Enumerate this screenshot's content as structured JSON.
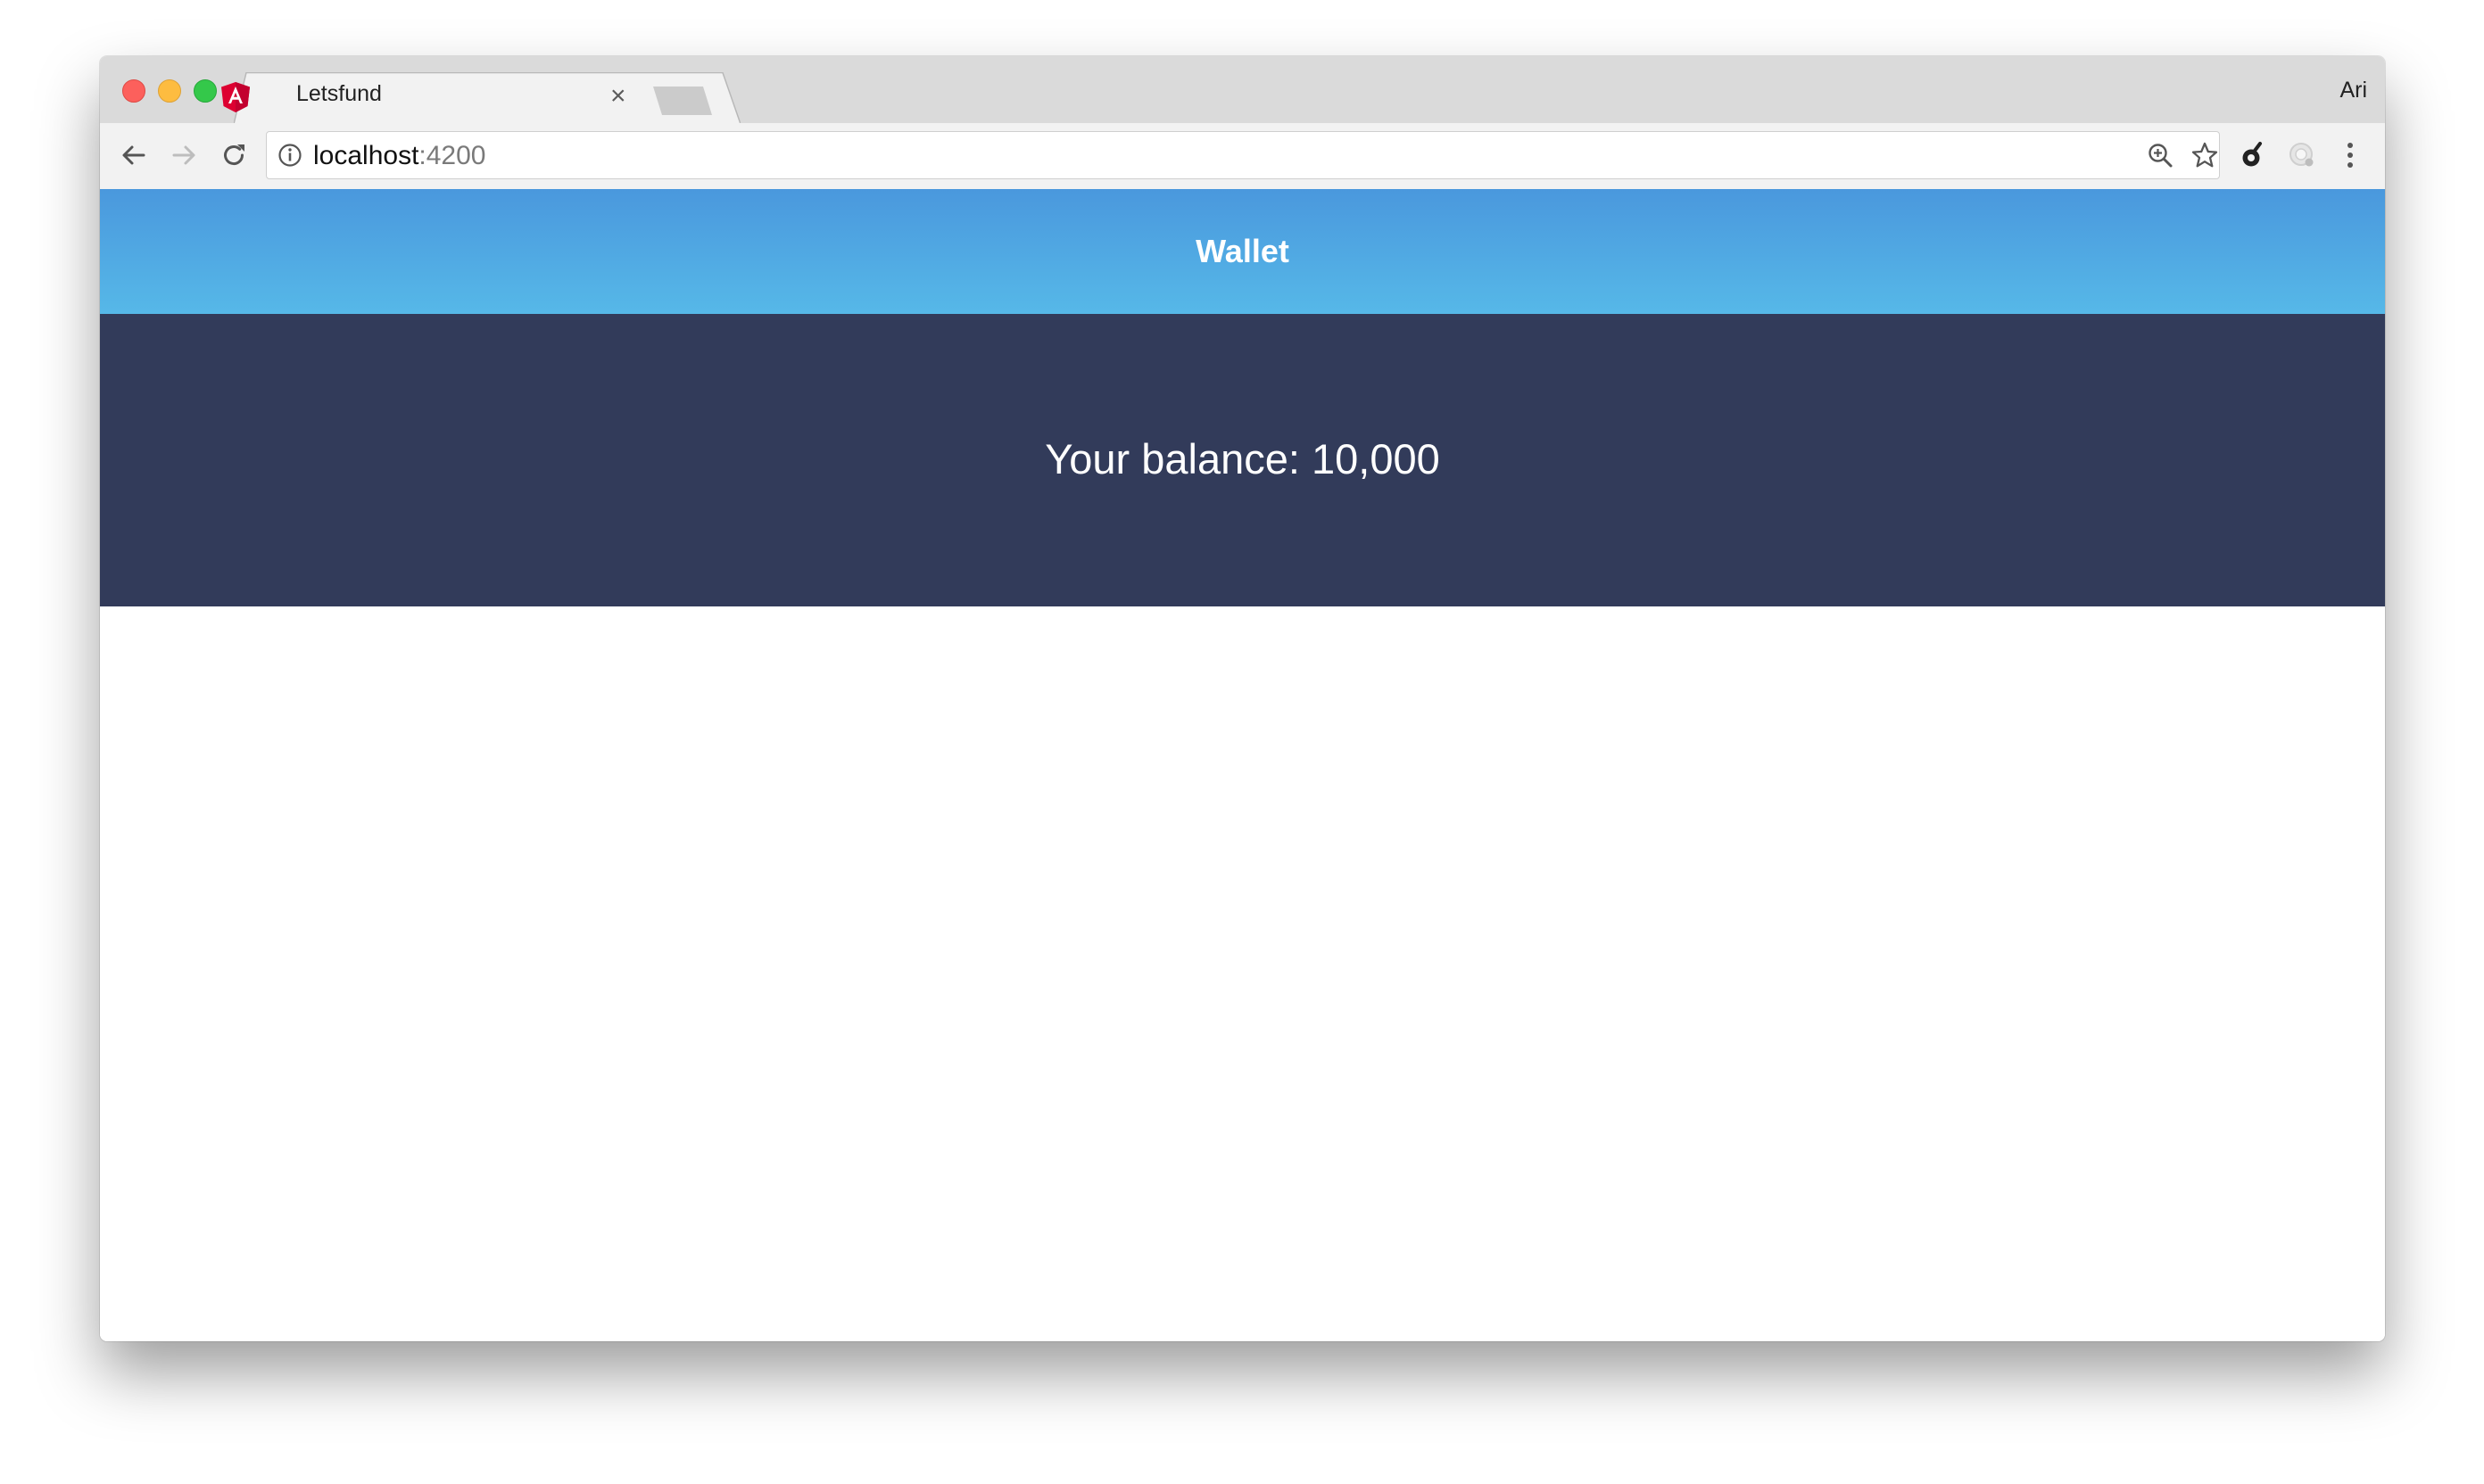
{
  "browser": {
    "tab": {
      "title": "Letsfund",
      "close_glyph": "×",
      "favicon": "angular-logo-icon"
    },
    "profile_name": "Ari",
    "address": {
      "host": "localhost",
      "port": ":4200"
    },
    "icons": [
      "back-arrow-icon",
      "forward-arrow-icon",
      "reload-icon",
      "info-icon",
      "zoom-icon",
      "star-icon",
      "extension-icon",
      "profile-extension-icon",
      "menu-kebab-icon"
    ]
  },
  "app": {
    "header_title": "Wallet",
    "header_color": "#4a9ddf",
    "panel_color": "#323b5a",
    "balance_label": "Your balance: ",
    "balance_value": "10,000"
  }
}
